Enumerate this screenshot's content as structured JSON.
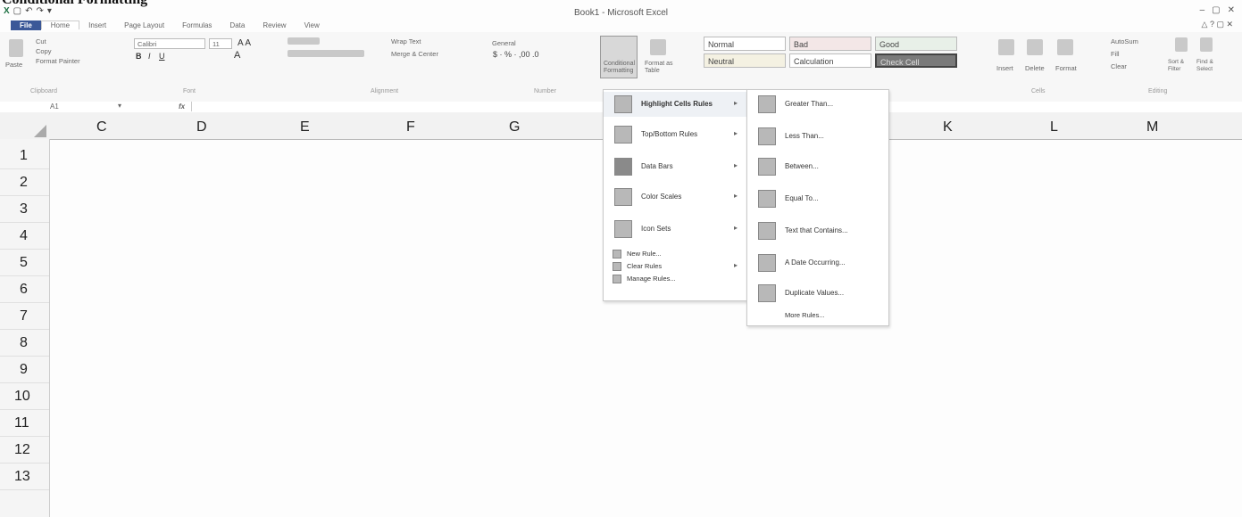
{
  "page_caption": "Conditional Formatting",
  "window": {
    "title": "Book1 - Microsoft Excel",
    "qat": [
      "X",
      "▢",
      "↶",
      "↷",
      "▾"
    ],
    "controls": [
      "–",
      "▢",
      "✕"
    ]
  },
  "ribbon_tabs": [
    "File",
    "Home",
    "Insert",
    "Page Layout",
    "Formulas",
    "Data",
    "Review",
    "View"
  ],
  "ribbon": {
    "clipboard": {
      "cut": "Cut",
      "copy": "Copy",
      "paste": "Paste",
      "format_painter": "Format Painter",
      "label": "Clipboard"
    },
    "font": {
      "name": "Calibri",
      "size": "11",
      "label": "Font"
    },
    "alignment": {
      "wrap_text": "Wrap Text",
      "merge": "Merge & Center",
      "label": "Alignment"
    },
    "number": {
      "format": "General",
      "label": "Number"
    },
    "conditional_formatting": "Conditional Formatting",
    "format_as_table": "Format as Table",
    "styles": {
      "normal": "Normal",
      "bad": "Bad",
      "good": "Good",
      "neutral": "Neutral",
      "calculation": "Calculation",
      "check_cell": "Check Cell"
    },
    "cells": {
      "insert": "Insert",
      "delete": "Delete",
      "format": "Format",
      "label": "Cells"
    },
    "editing": {
      "autosum": "AutoSum",
      "fill": "Fill",
      "clear": "Clear",
      "sort_filter": "Sort & Filter",
      "find_select": "Find & Select",
      "label": "Editing"
    }
  },
  "formula_bar": {
    "name_box": "A1",
    "fx": "fx"
  },
  "columns": [
    "C",
    "D",
    "E",
    "F",
    "G",
    "K",
    "L",
    "M"
  ],
  "rows": [
    "1",
    "2",
    "3",
    "4",
    "5",
    "6",
    "7",
    "8",
    "9",
    "10",
    "11",
    "12",
    "13"
  ],
  "cf_menu": {
    "items": [
      "Highlight Cells Rules",
      "Top/Bottom Rules",
      "Data Bars",
      "Color Scales",
      "Icon Sets"
    ],
    "small_items": [
      "New Rule...",
      "Clear Rules",
      "Manage Rules..."
    ]
  },
  "highlight_submenu": {
    "items": [
      "Greater Than...",
      "Less Than...",
      "Between...",
      "Equal To...",
      "Text that Contains...",
      "A Date Occurring...",
      "Duplicate Values..."
    ],
    "more": "More Rules..."
  }
}
